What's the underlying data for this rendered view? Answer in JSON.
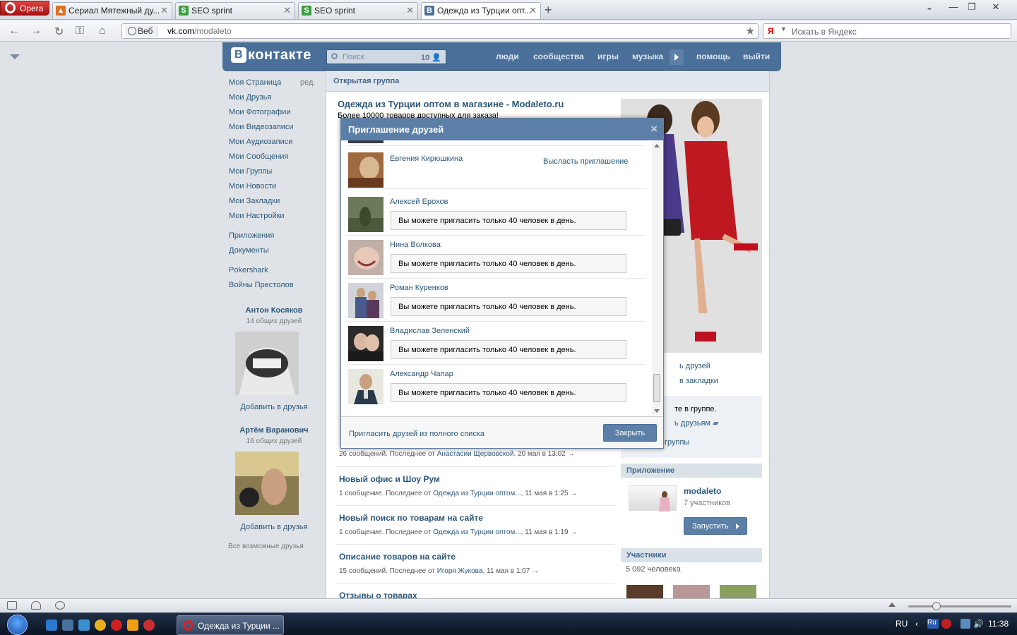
{
  "browser": {
    "menu_label": "Opera",
    "tabs": [
      {
        "title": "Сериал Мятежный ду...",
        "icon": "fire"
      },
      {
        "title": "SEO sprint",
        "icon": "S"
      },
      {
        "title": "SEO sprint",
        "icon": "S"
      },
      {
        "title": "Одежда из Турции опт...",
        "icon": "B"
      }
    ],
    "address_badge": "Веб",
    "url_host": "vk.com",
    "url_path": "/modaleto",
    "search_placeholder": "Искать в Яндекс"
  },
  "vk": {
    "logo_text": "контакте",
    "logo_letter": "В",
    "search_placeholder": "Поиск",
    "search_count": "10",
    "nav": [
      "люди",
      "сообщества",
      "игры",
      "музыка",
      "помощь",
      "выйти"
    ],
    "edit_label": "ред.",
    "menu": [
      "Моя Страница",
      "Мои Друзья",
      "Мои Фотографии",
      "Мои Видеозаписи",
      "Мои Аудиозаписи",
      "Мои Сообщения",
      "Мои Группы",
      "Мои Новости",
      "Мои Закладки",
      "Мои Настройки"
    ],
    "menu2": [
      "Приложения",
      "Документы"
    ],
    "menu3": [
      "Pokershark",
      "Войны Престолов"
    ],
    "suggestions": [
      {
        "name": "Антон Косяков",
        "mutual": "14 общих друзей",
        "add": "Добавить в друзья"
      },
      {
        "name": "Артём Варанович",
        "mutual": "16 общих друзей",
        "add": "Добавить в друзья"
      }
    ],
    "all_suggestions": "Все возможные друзья"
  },
  "group": {
    "header": "Открытая группа",
    "title": "Одежда из Турции оптом в магазине - Modaleto.ru",
    "desc": "Более 10000 товаров доступных для заказа!",
    "links": [
      "ь друзей",
      "в закладки"
    ],
    "box_lines": [
      "те в группе.",
      "ь друзьям",
      "группы"
    ],
    "app_section": "Приложение",
    "app_name": "modaleto",
    "app_members": "7 участников",
    "launch_label": "Запустить",
    "members_section": "Участники",
    "members_count": "5 092 человека"
  },
  "topics": [
    {
      "title": "",
      "count": "26 сообщений. Последнее от ",
      "author": "Анастасии Щервовской",
      "time": ", 20 мая в 13:02 →"
    },
    {
      "title": "Новый офис и Шоу Рум",
      "count": "1 сообщение. Последнее от ",
      "author": "Одежда из Турции оптом...",
      "time": ", 11 мая в 1:25 →"
    },
    {
      "title": "Новый поиск по товарам на сайте",
      "count": "1 сообщение. Последнее от ",
      "author": "Одежда из Турции оптом...",
      "time": ", 11 мая в 1:19 →"
    },
    {
      "title": "Описание товаров на сайте",
      "count": "15 сообщений. Последнее от ",
      "author": "Игоря Жукова",
      "time": ", 11 мая в 1:07 →"
    },
    {
      "title": "Отзывы о товарах",
      "count": "",
      "author": "",
      "time": ""
    }
  ],
  "modal": {
    "title": "Приглашение друзей",
    "close_icon": "×",
    "friends": [
      {
        "name": "Евгения Кирюшкина",
        "action": "Высласть приглашение",
        "limit": ""
      },
      {
        "name": "Алексей Ерохов",
        "action": "",
        "limit": "Вы можете пригласить только 40 человек в день."
      },
      {
        "name": "Нина Волкова",
        "action": "",
        "limit": "Вы можете пригласить только 40 человек в день."
      },
      {
        "name": "Роман Куренков",
        "action": "",
        "limit": "Вы можете пригласить только 40 человек в день."
      },
      {
        "name": "Владислав Зеленский",
        "action": "",
        "limit": "Вы можете пригласить только 40 человек в день."
      },
      {
        "name": "Александр Чапар",
        "action": "",
        "limit": "Вы можете пригласить только 40 человек в день."
      }
    ],
    "invite_all": "Пригласить друзей из полного списка",
    "close_label": "Закрыть"
  },
  "taskbar": {
    "task_title": "Одежда из Турции ...",
    "lang": "RU",
    "clock": "11:38"
  },
  "colors": {
    "vk_blue": "#4a6f98",
    "link": "#2b587a",
    "header_text": "#45688e"
  }
}
